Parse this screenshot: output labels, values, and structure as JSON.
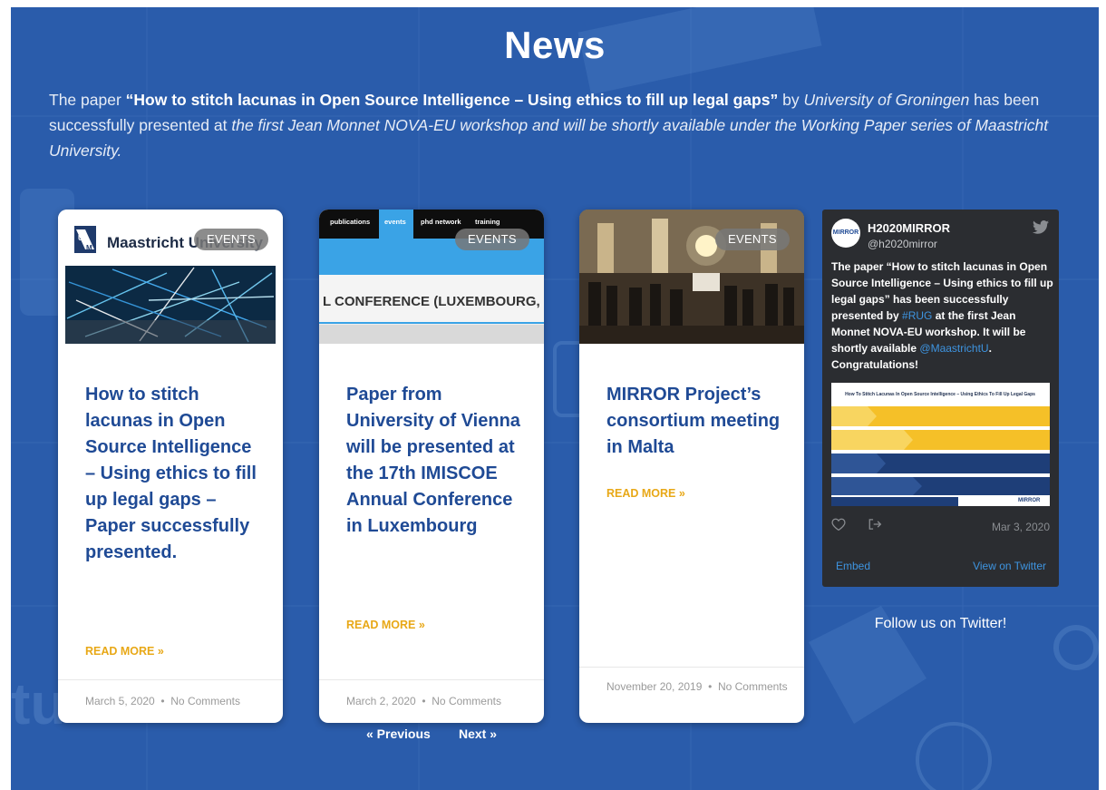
{
  "page": {
    "title": "News"
  },
  "intro": {
    "prefix": "The paper ",
    "paper_title": "“How to stitch lacunas in Open Source Intelligence – Using ethics to fill up legal gaps”",
    "by": " by ",
    "institution": "University of Groningen",
    "middle": "  has been successfully presented at ",
    "rest": "the first Jean Monnet NOVA-EU workshop and will be shortly available under the Working Paper series of Maastricht University."
  },
  "cards": [
    {
      "badge": "EVENTS",
      "image_logo_text": "Maastricht University",
      "title": "How to stitch lacunas in Open Source Intelligence – Using ethics to fill up legal gaps – Paper successfully presented.",
      "read_more": "READ MORE »",
      "date": "March 5, 2020",
      "comments": "No Comments"
    },
    {
      "badge": "EVENTS",
      "image_nav": [
        "publications",
        "events",
        "phd network",
        "training"
      ],
      "image_banner_text": "L CONFERENCE (LUXEMBOURG,",
      "title": "Paper from University of Vienna will be presented at the 17th IMISCOE Annual Conference in Luxembourg",
      "read_more": "READ MORE »",
      "date": "March 2, 2020",
      "comments": "No Comments"
    },
    {
      "badge": "EVENTS",
      "title": "MIRROR Project’s consortium meeting in Malta",
      "read_more": "READ MORE »",
      "date": "November 20, 2019",
      "comments": "No Comments"
    }
  ],
  "pagination": {
    "previous": "« Previous",
    "next": "Next »"
  },
  "tweet": {
    "avatar_text": "MIRROR",
    "name": "H2020MIRROR",
    "handle": "@h2020mirror",
    "text_part1": "The paper “How to stitch lacunas in Open Source Intelligence – Using ethics to fill up legal gaps” has been successfully presented by ",
    "hashtag": "#RUG",
    "text_part2": " at the first Jean Monnet NOVA-EU workshop. It will be shortly available ",
    "mention": "@MaastrichtU",
    "text_part3": ". Congratulations!",
    "image_title": "How To Stitch Lacunas In Open Source Intelligence – Using Ethics To Fill Up Legal Gaps",
    "date": "Mar 3, 2020",
    "embed": "Embed",
    "view_on_twitter": "View on Twitter"
  },
  "follow_text": "Follow us on Twitter!",
  "colors": {
    "background": "#2a5cab",
    "card_title": "#1f4a95",
    "read_more": "#e8a817",
    "tweet_bg": "#2b2d31",
    "link": "#3e94e0"
  }
}
